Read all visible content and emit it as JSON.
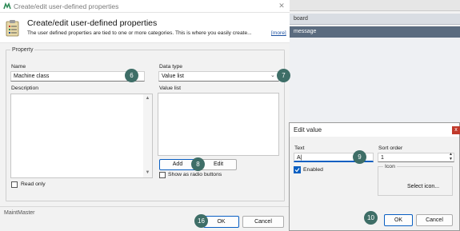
{
  "background_app": {
    "strip_text": "board",
    "header_text": "message"
  },
  "main_dialog": {
    "title": "Create/edit user-defined properties",
    "close_glyph": "✕",
    "header": {
      "title": "Create/edit user-defined properties",
      "description": "The user defined properties are tied to one or more categories. This is where you easily create...",
      "more_link": "[more]"
    },
    "property_group": {
      "legend": "Property",
      "name_label": "Name",
      "name_value": "Machine class",
      "description_label": "Description",
      "read_only_label": "Read only",
      "data_type_label": "Data type",
      "data_type_value": "Value list",
      "value_list_label": "Value list",
      "add_label": "Add",
      "edit_label": "Edit",
      "radio_label": "Show as radio buttons"
    },
    "footer": {
      "brand": "MaintMaster",
      "ok_label": "OK",
      "cancel_label": "Cancel"
    }
  },
  "edit_value_dialog": {
    "title": "Edit value",
    "close_glyph": "x",
    "text_label": "Text",
    "text_value": "A|",
    "sort_order_label": "Sort order",
    "sort_order_value": "1",
    "enabled_label": "Enabled",
    "icon_legend": "Icon",
    "select_icon_label": "Select icon...",
    "ok_label": "OK",
    "cancel_label": "Cancel"
  },
  "callouts": {
    "c6": "6",
    "c7": "7",
    "c8": "8",
    "c9": "9",
    "c10": "10",
    "c16": "16"
  },
  "colors": {
    "accent": "#0a5fc2",
    "callout": "#3e6e67",
    "close_red": "#c0392b"
  },
  "icons": {
    "app": "maintmaster-logo-icon",
    "header": "clipboard-icon",
    "dropdown": "chevron-down-icon",
    "check": "checkmark-icon"
  }
}
